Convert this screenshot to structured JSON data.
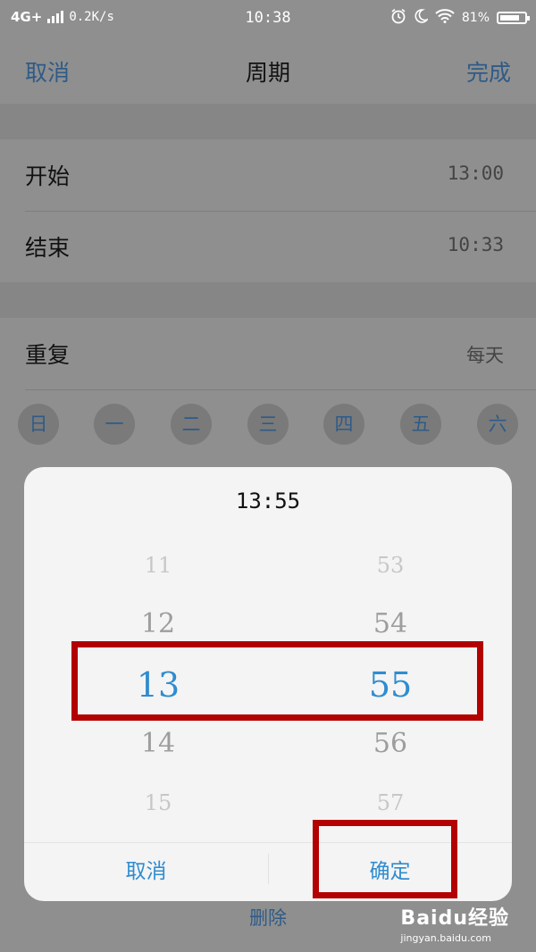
{
  "status_bar": {
    "network": "4G+",
    "speed": "0.2K/s",
    "time": "10:38",
    "battery": "81%",
    "battery_level": 0.81
  },
  "nav": {
    "cancel": "取消",
    "title": "周期",
    "done": "完成"
  },
  "schedule": {
    "start_label": "开始",
    "start_value": "13:00",
    "end_label": "结束",
    "end_value": "10:33",
    "repeat_label": "重复",
    "repeat_value": "每天",
    "days": [
      "日",
      "一",
      "二",
      "三",
      "四",
      "五",
      "六"
    ]
  },
  "delete_label": "删除",
  "time_picker": {
    "title": "13:55",
    "hours": [
      "11",
      "12",
      "13",
      "14",
      "15"
    ],
    "minutes": [
      "53",
      "54",
      "55",
      "56",
      "57"
    ],
    "selected_hour": "13",
    "selected_minute": "55",
    "cancel": "取消",
    "confirm": "确定"
  },
  "watermark": {
    "logo": "Baidu经验",
    "url": "jingyan.baidu.com"
  },
  "colors": {
    "accent": "#2f8cd0",
    "highlight": "#b30000",
    "overlay": "#8f8f8f"
  }
}
